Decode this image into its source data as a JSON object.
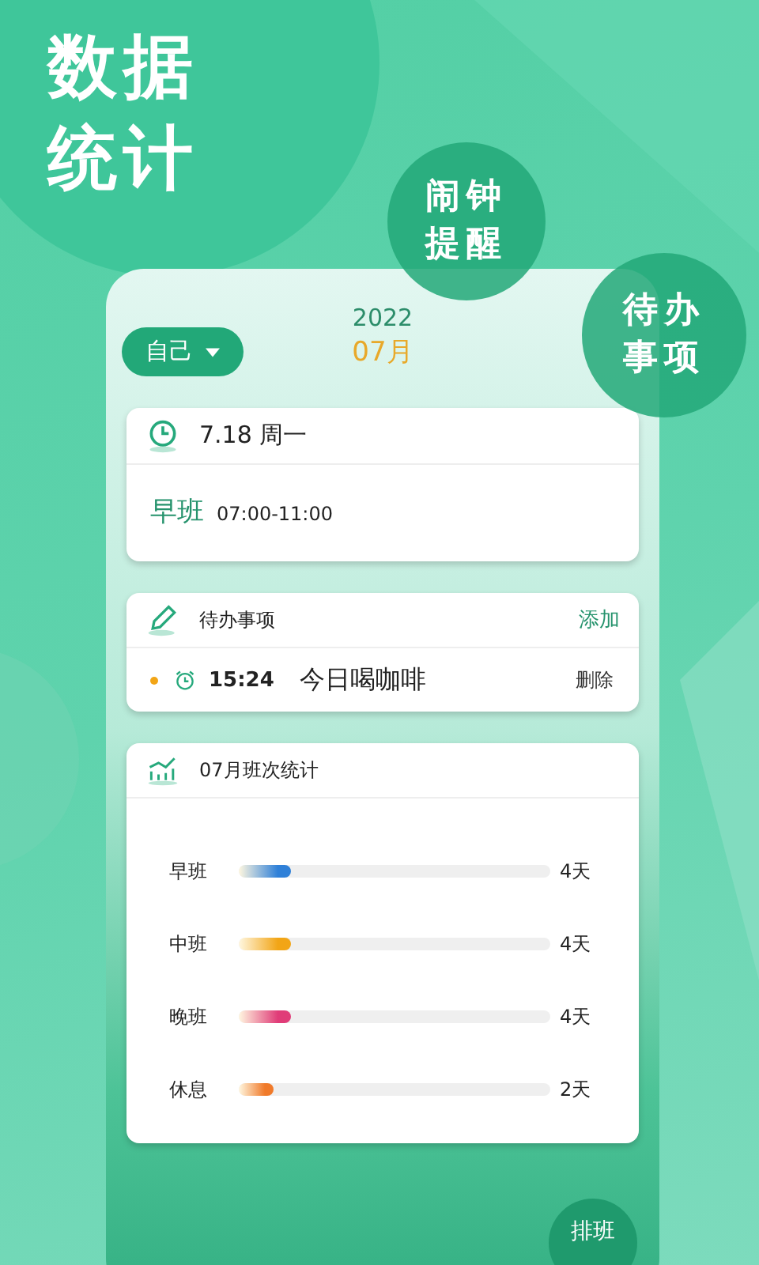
{
  "headline": [
    "数据",
    "统计"
  ],
  "bubbles": [
    {
      "lines": [
        "闹钟",
        "提醒"
      ]
    },
    {
      "lines": [
        "待办",
        "事项"
      ]
    }
  ],
  "header": {
    "filter": "自己",
    "year": "2022",
    "month": "07月"
  },
  "day_card": {
    "date": "7.18 周一",
    "shift": "早班",
    "hours": "07:00-11:00"
  },
  "todo_card": {
    "title": "待办事项",
    "add": "添加",
    "items": [
      {
        "time": "15:24",
        "text": "今日喝咖啡",
        "delete": "删除"
      }
    ]
  },
  "stats_card": {
    "title": "07月班次统计",
    "rows": [
      {
        "label": "早班",
        "level": 0.17,
        "value": "4天",
        "color": "#2f80d8"
      },
      {
        "label": "中班",
        "level": 0.17,
        "value": "4天",
        "color": "#f2a516"
      },
      {
        "label": "晚班",
        "level": 0.17,
        "value": "4天",
        "color": "#e03c78"
      },
      {
        "label": "休息",
        "level": 0.11,
        "value": "2天",
        "color": "#f07a2a"
      }
    ]
  },
  "fab": "排班"
}
